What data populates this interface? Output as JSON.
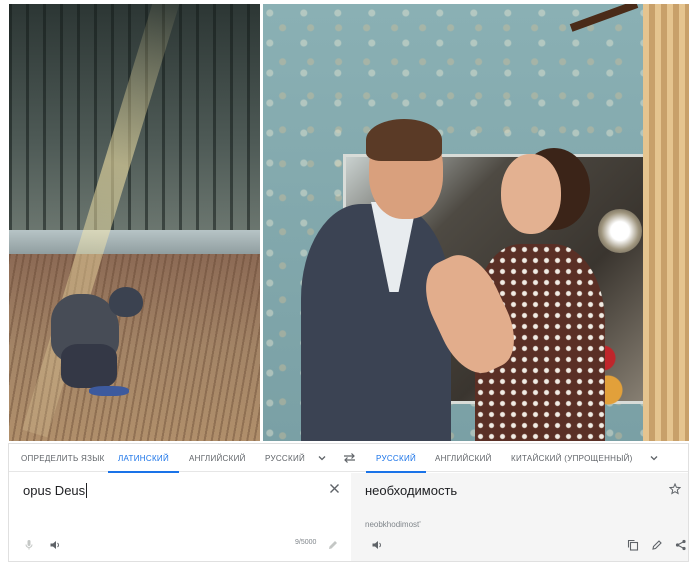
{
  "photos": {
    "left_description": "photo-child-in-meadow",
    "right_description": "photo-couple-by-mirror"
  },
  "translator": {
    "source_tabs": [
      {
        "label": "ОПРЕДЕЛИТЬ ЯЗЫК",
        "active": false
      },
      {
        "label": "ЛАТИНСКИЙ",
        "active": true
      },
      {
        "label": "АНГЛИЙСКИЙ",
        "active": false
      },
      {
        "label": "РУССКИЙ",
        "active": false
      }
    ],
    "target_tabs": [
      {
        "label": "РУССКИЙ",
        "active": true
      },
      {
        "label": "АНГЛИЙСКИЙ",
        "active": false
      },
      {
        "label": "КИТАЙСКИЙ (УПРОЩЕННЫЙ)",
        "active": false
      }
    ],
    "source_text": "opus Deus",
    "char_counter": "9/5000",
    "target_text": "необходимость",
    "transliteration": "neobkhodimost'",
    "accent_color": "#1a73e8",
    "icons": [
      "chevron-down-icon",
      "swap-icon",
      "close-icon",
      "microphone-icon",
      "speaker-icon",
      "pencil-icon",
      "star-icon",
      "copy-icon",
      "share-icon"
    ]
  }
}
